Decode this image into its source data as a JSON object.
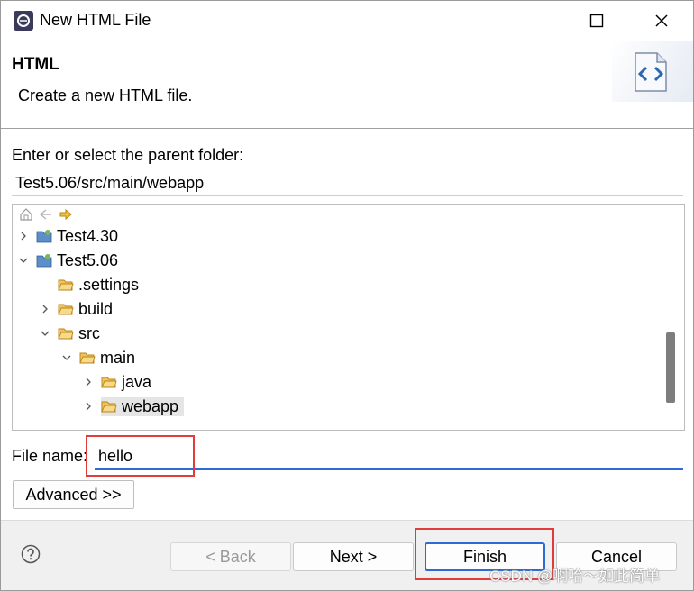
{
  "window": {
    "title": "New HTML File"
  },
  "banner": {
    "title": "HTML",
    "description": "Create a new HTML file."
  },
  "folder": {
    "label": "Enter or select the parent folder:",
    "path_value": "Test5.06/src/main/webapp"
  },
  "tree": {
    "items": [
      {
        "label": "Test4.30",
        "icon": "project-icon",
        "expander": "collapsed"
      },
      {
        "label": "Test5.06",
        "icon": "project-icon",
        "expander": "expanded"
      },
      {
        "label": ".settings",
        "icon": "folder-icon",
        "expander": "none"
      },
      {
        "label": "build",
        "icon": "folder-icon",
        "expander": "collapsed"
      },
      {
        "label": "src",
        "icon": "folder-icon",
        "expander": "expanded"
      },
      {
        "label": "main",
        "icon": "folder-icon",
        "expander": "expanded"
      },
      {
        "label": "java",
        "icon": "folder-icon",
        "expander": "collapsed"
      },
      {
        "label": "webapp",
        "icon": "folder-icon",
        "expander": "collapsed",
        "selected": true
      }
    ]
  },
  "file": {
    "label": "File name:",
    "value": "hello"
  },
  "buttons": {
    "advanced": "Advanced >>",
    "back": "< Back",
    "next": "Next >",
    "finish": "Finish",
    "cancel": "Cancel"
  },
  "watermark": "CSDN @啊哈～如此简单",
  "colors": {
    "accent": "#2d6bd4",
    "highlight": "#e23b3b",
    "folder": "#e8a33a"
  }
}
